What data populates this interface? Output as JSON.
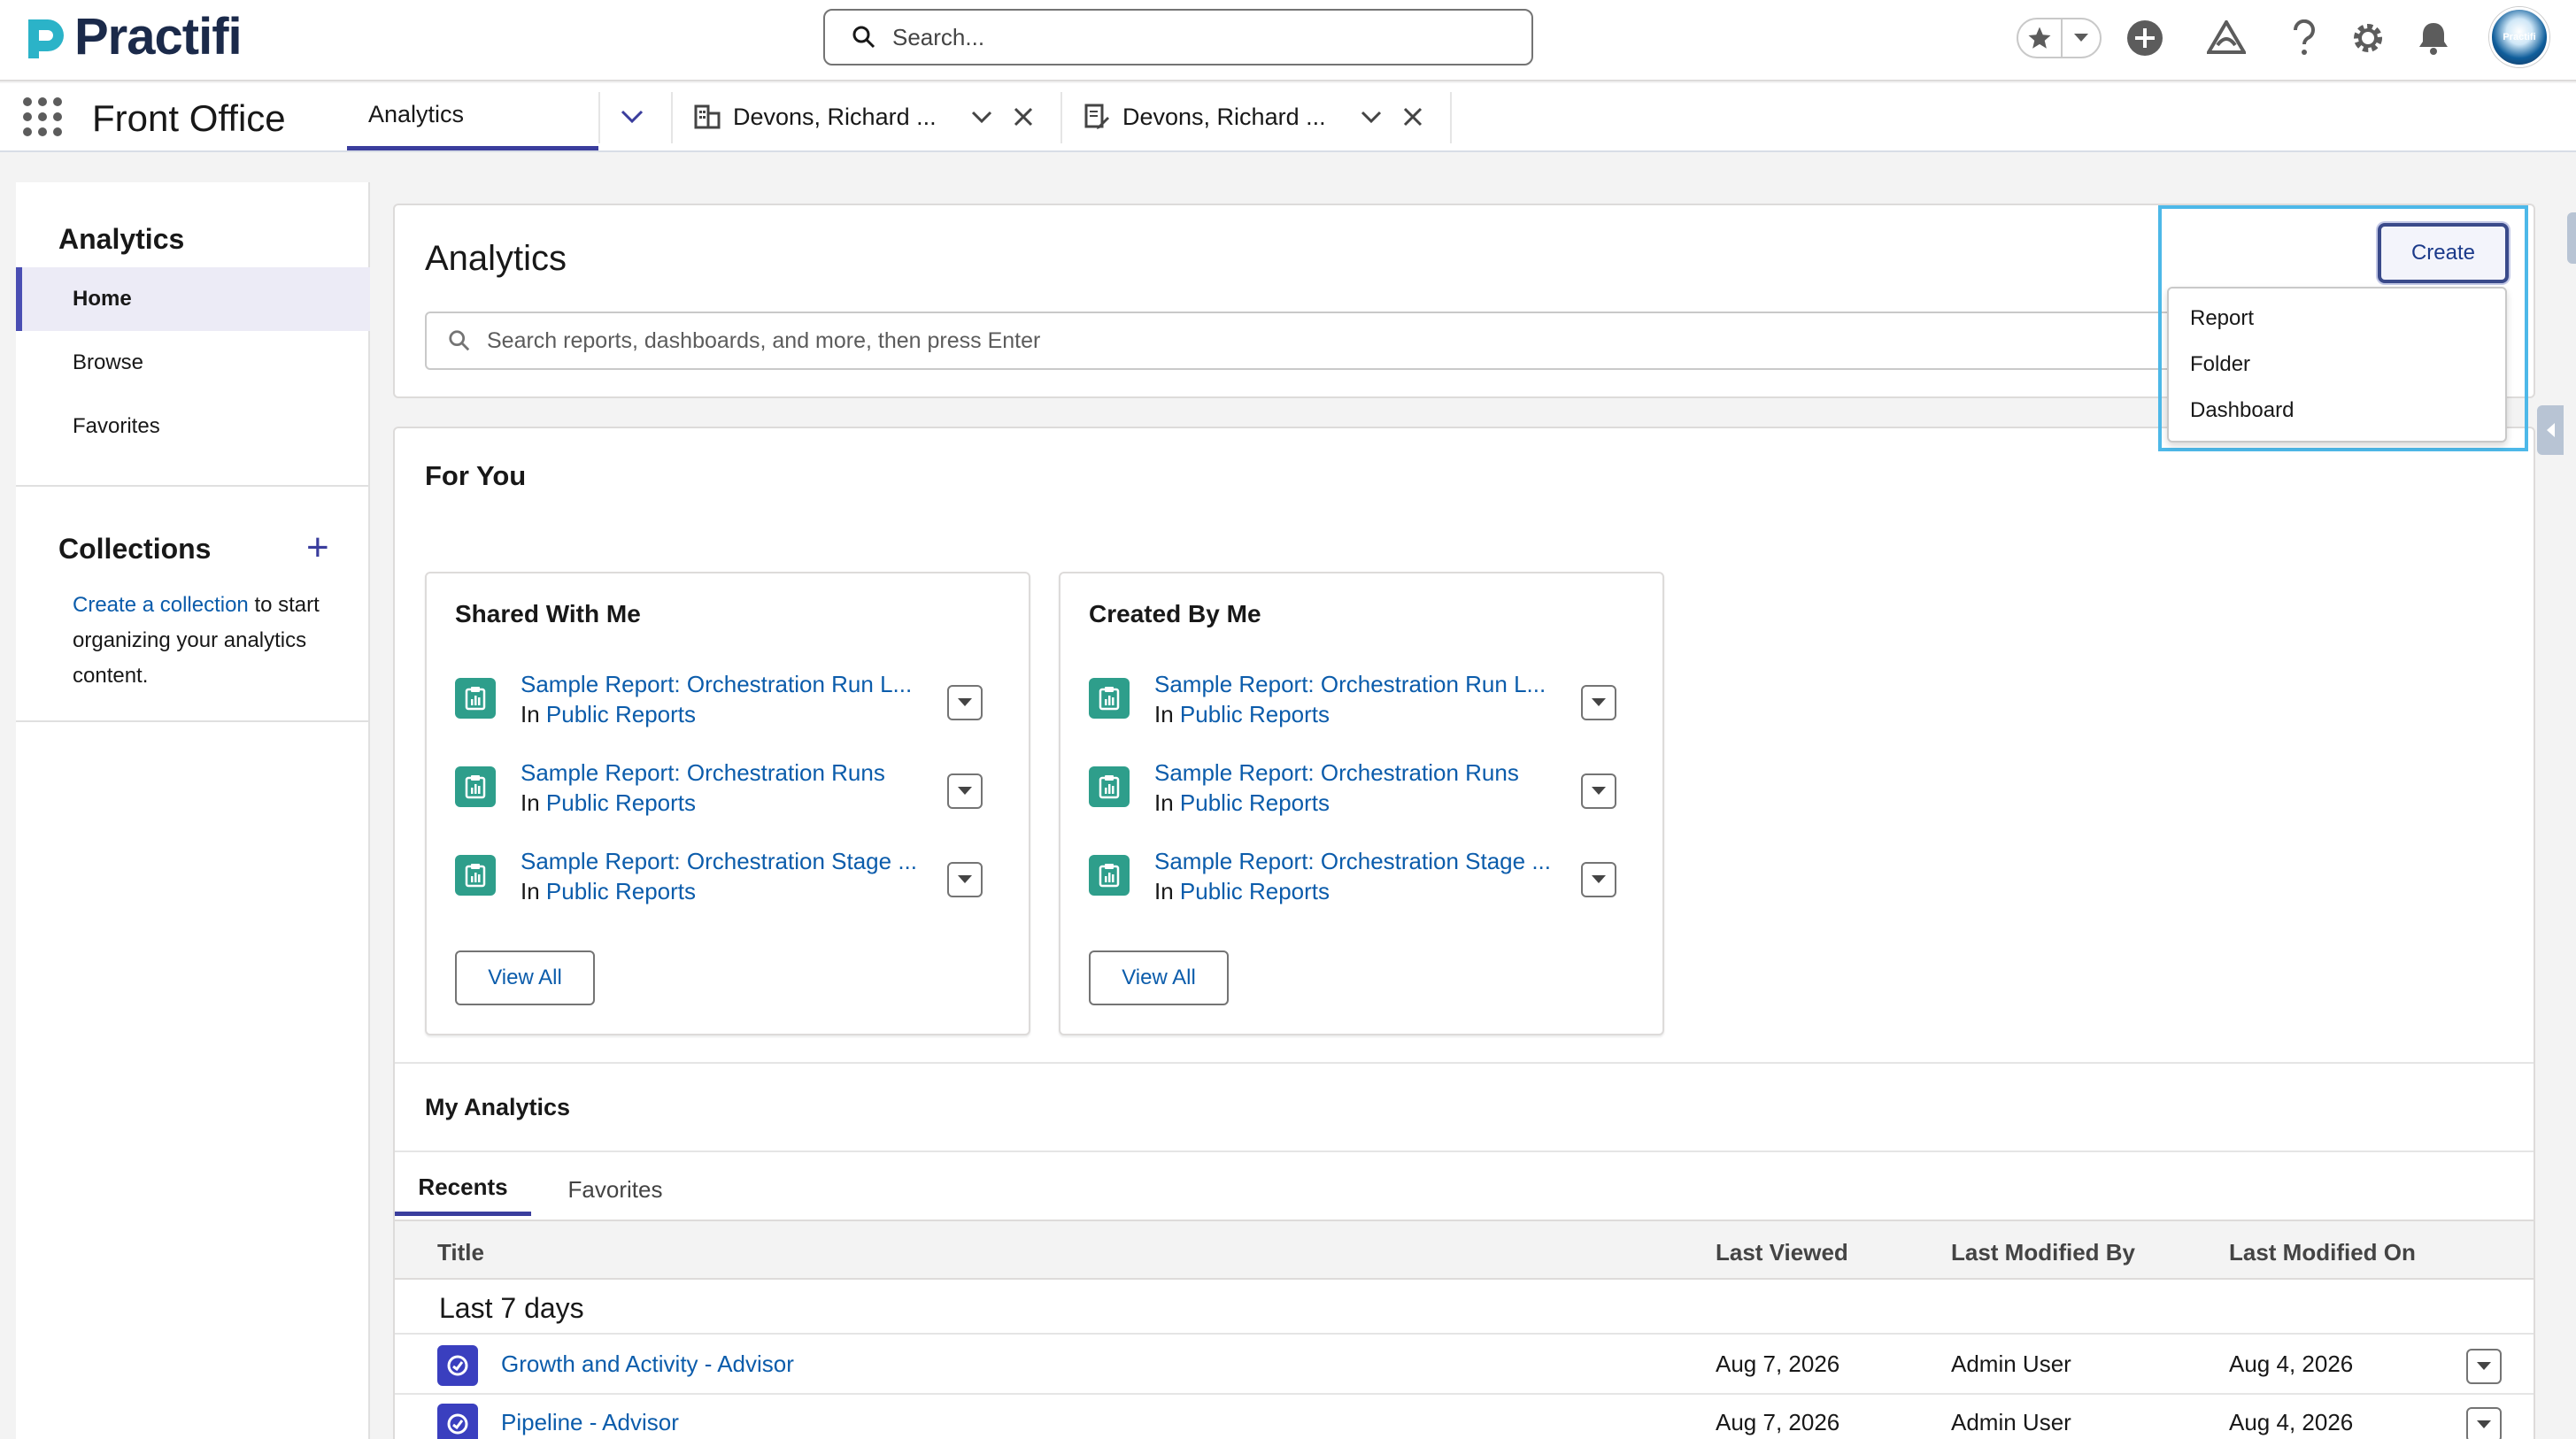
{
  "header": {
    "brand": "Practifi",
    "search_placeholder": "Search...",
    "avatar_text": "Practifi",
    "icons": [
      "favorites-star-icon",
      "favorites-dropdown-icon",
      "add-icon",
      "trailhead-icon",
      "help-icon",
      "setup-gear-icon",
      "notifications-bell-icon"
    ]
  },
  "nav": {
    "app_name": "Front Office",
    "tabs": [
      {
        "label": "Analytics",
        "active": true
      },
      {
        "label": "Devons, Richard ...",
        "icon": "building-icon"
      },
      {
        "label": "Devons, Richard ...",
        "icon": "edit-document-icon"
      }
    ]
  },
  "sidebar": {
    "title": "Analytics",
    "items": [
      "Home",
      "Browse",
      "Favorites"
    ],
    "collections_title": "Collections",
    "collections_link": "Create a collection",
    "collections_text": "to start organizing your analytics content."
  },
  "main": {
    "title": "Analytics",
    "search_placeholder": "Search reports, dashboards, and more, then press Enter",
    "create_label": "Create",
    "create_menu": [
      "Report",
      "Folder",
      "Dashboard"
    ],
    "for_you_title": "For You",
    "shared": {
      "title": "Shared With Me",
      "items": [
        {
          "name": "Sample Report: Orchestration Run L...",
          "in": "In",
          "folder": "Public Reports"
        },
        {
          "name": "Sample Report: Orchestration Runs",
          "in": "In",
          "folder": "Public Reports"
        },
        {
          "name": "Sample Report: Orchestration Stage ...",
          "in": "In",
          "folder": "Public Reports"
        }
      ],
      "view_all": "View All"
    },
    "created": {
      "title": "Created By Me",
      "items": [
        {
          "name": "Sample Report: Orchestration Run L...",
          "in": "In",
          "folder": "Public Reports"
        },
        {
          "name": "Sample Report: Orchestration Runs",
          "in": "In",
          "folder": "Public Reports"
        },
        {
          "name": "Sample Report: Orchestration Stage ...",
          "in": "In",
          "folder": "Public Reports"
        }
      ],
      "view_all": "View All"
    },
    "my_analytics": {
      "title": "My Analytics",
      "tabs": [
        "Recents",
        "Favorites"
      ],
      "columns": [
        "Title",
        "Last Viewed",
        "Last Modified By",
        "Last Modified On"
      ],
      "group_label": "Last 7 days",
      "rows": [
        {
          "title": "Growth and Activity - Advisor",
          "last_viewed": "Aug 7, 2026",
          "modified_by": "Admin User",
          "modified_on": "Aug 4, 2026"
        },
        {
          "title": "Pipeline - Advisor",
          "last_viewed": "Aug 7, 2026",
          "modified_by": "Admin User",
          "modified_on": "Aug 4, 2026"
        }
      ]
    }
  },
  "colors": {
    "accent": "#3a3d9d",
    "link": "#0b5cab",
    "report_icon": "#2e9e8b",
    "dashboard_icon": "#3a3fbf",
    "highlight": "#4db8e8"
  }
}
